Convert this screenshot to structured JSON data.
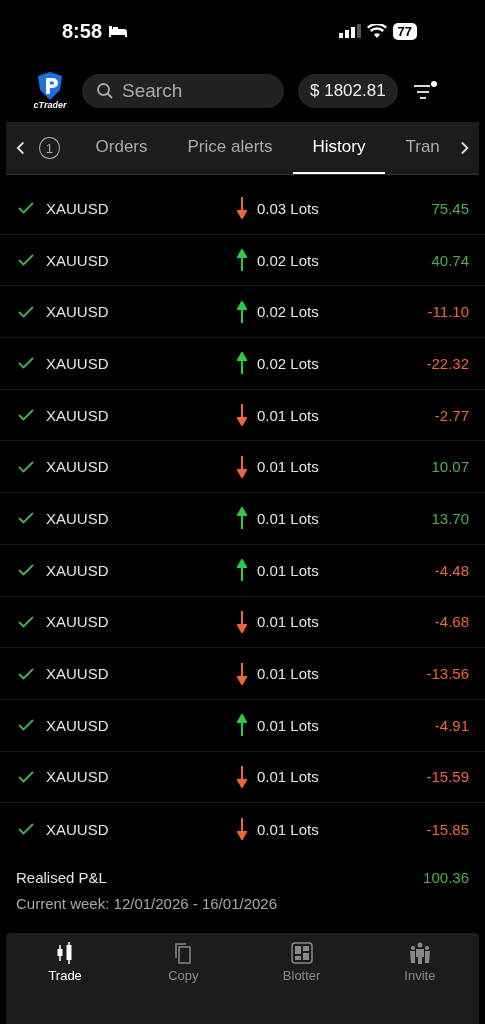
{
  "status_bar": {
    "time": "8:58",
    "battery": "77"
  },
  "header": {
    "logo_text": "cTrader",
    "search": {
      "placeholder": "Search"
    },
    "balance": "$ 1802.81",
    "filter_badge": true
  },
  "tabs": [
    {
      "label": "1",
      "kind": "badge",
      "selected": false
    },
    {
      "label": "Orders",
      "kind": "text",
      "selected": false
    },
    {
      "label": "Price alerts",
      "kind": "text",
      "selected": false
    },
    {
      "label": "History",
      "kind": "text",
      "selected": true
    },
    {
      "label": "Tran",
      "kind": "text",
      "selected": false
    }
  ],
  "trades": [
    {
      "symbol": "XAUUSD",
      "up": false,
      "volume": "0.03 Lots",
      "pnl": "75.45",
      "profit": true
    },
    {
      "symbol": "XAUUSD",
      "up": true,
      "volume": "0.02 Lots",
      "pnl": "40.74",
      "profit": true
    },
    {
      "symbol": "XAUUSD",
      "up": true,
      "volume": "0.02 Lots",
      "pnl": "-11.10",
      "profit": false
    },
    {
      "symbol": "XAUUSD",
      "up": true,
      "volume": "0.02 Lots",
      "pnl": "-22.32",
      "profit": false
    },
    {
      "symbol": "XAUUSD",
      "up": false,
      "volume": "0.01 Lots",
      "pnl": "-2.77",
      "profit": false
    },
    {
      "symbol": "XAUUSD",
      "up": false,
      "volume": "0.01 Lots",
      "pnl": "10.07",
      "profit": true
    },
    {
      "symbol": "XAUUSD",
      "up": true,
      "volume": "0.01 Lots",
      "pnl": "13.70",
      "profit": true
    },
    {
      "symbol": "XAUUSD",
      "up": true,
      "volume": "0.01 Lots",
      "pnl": "-4.48",
      "profit": false
    },
    {
      "symbol": "XAUUSD",
      "up": false,
      "volume": "0.01 Lots",
      "pnl": "-4.68",
      "profit": false
    },
    {
      "symbol": "XAUUSD",
      "up": false,
      "volume": "0.01 Lots",
      "pnl": "-13.56",
      "profit": false
    },
    {
      "symbol": "XAUUSD",
      "up": true,
      "volume": "0.01 Lots",
      "pnl": "-4.91",
      "profit": false
    },
    {
      "symbol": "XAUUSD",
      "up": false,
      "volume": "0.01 Lots",
      "pnl": "-15.59",
      "profit": false
    },
    {
      "symbol": "XAUUSD",
      "up": false,
      "volume": "0.01 Lots",
      "pnl": "-15.85",
      "profit": false
    }
  ],
  "summary": {
    "label": "Realised P&L",
    "value": "100.36",
    "profit": true,
    "period": "Current week: 12/01/2026 - 16/01/2026"
  },
  "bottom_nav": [
    {
      "label": "Trade",
      "kind": "trade",
      "selected": true
    },
    {
      "label": "Copy",
      "kind": "copy",
      "selected": false
    },
    {
      "label": "Blotter",
      "kind": "blotter",
      "selected": false
    },
    {
      "label": "Invite",
      "kind": "invite",
      "selected": false
    }
  ]
}
